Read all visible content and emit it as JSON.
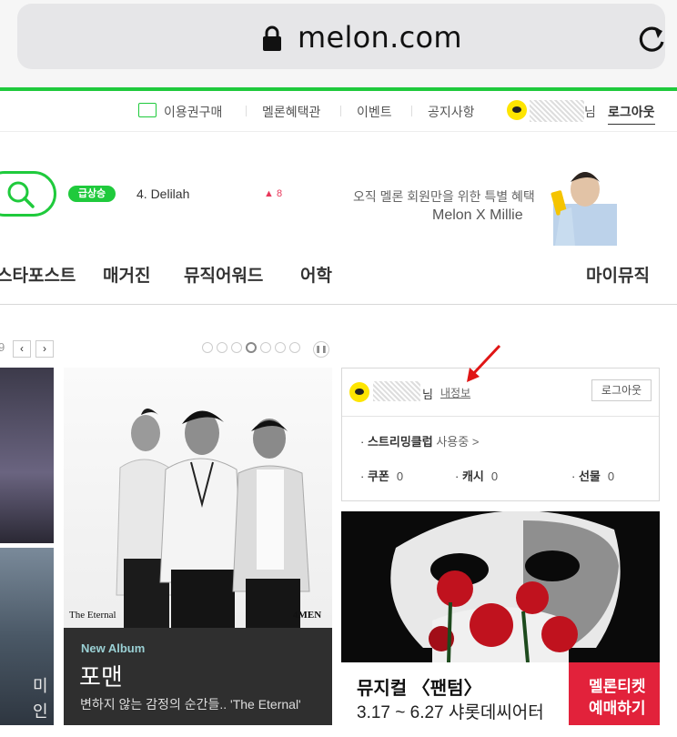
{
  "browser": {
    "url": "melon.com"
  },
  "util_nav": {
    "items": [
      "이용권구매",
      "멜론혜택관",
      "이벤트",
      "공지사항"
    ],
    "user_suffix": "님",
    "logout": "로그아웃"
  },
  "search_area": {
    "rising_badge": "급상승",
    "chart_song": "4. Delilah",
    "chart_change": "8",
    "promo_line1": "오직 멜론 회원만을 위한 특별 혜택",
    "promo_line2": "Melon X Millie"
  },
  "gnb": {
    "items": [
      "스타포스트",
      "매거진",
      "뮤직어워드",
      "어학"
    ],
    "right": "마이뮤직"
  },
  "slider": {
    "page": "9",
    "prev": "‹",
    "next": "›",
    "pause": "❚❚",
    "dot_count": 7,
    "active_dot": 4
  },
  "left_panel": {
    "partial_text1": "미",
    "partial_text2": "인"
  },
  "album_banner": {
    "tag_left": "The Eternal",
    "tag_right": "4MEN",
    "label": "New Album",
    "title": "포맨",
    "desc": "변하지 않는 감정의 순간들.. 'The Eternal'"
  },
  "login_box": {
    "user_suffix": "님",
    "my_info": "내정보",
    "logout": "로그아웃",
    "streaming": "스트리밍클럽",
    "streaming_status": "사용중 >",
    "stats": [
      {
        "label": "쿠폰",
        "value": "0"
      },
      {
        "label": "캐시",
        "value": "0"
      },
      {
        "label": "선물",
        "value": "0"
      }
    ]
  },
  "musical_banner": {
    "title": "뮤지컬 〈팬텀〉",
    "dates": "3.17 ~ 6.27 샤롯데씨어터",
    "badge_line1": "멜론티켓",
    "badge_line2": "예매하기"
  },
  "colors": {
    "brand_green": "#1fca3c",
    "kakao_yellow": "#fee500",
    "ticket_red": "#e2223b"
  }
}
